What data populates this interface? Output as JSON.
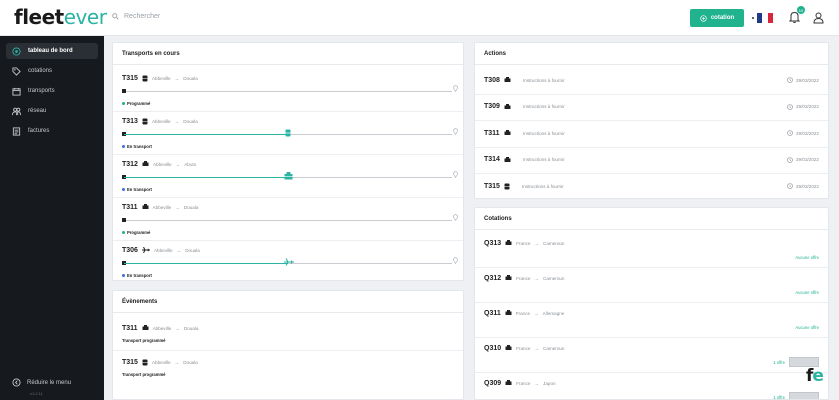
{
  "header": {
    "logo_part1": "fleet",
    "logo_part2": "ever",
    "search_placeholder": "Rechercher",
    "cotation_button": "cotation",
    "notifications_count": "10"
  },
  "sidebar": {
    "items": [
      {
        "label": "tableau de bord",
        "icon": "dashboard-icon"
      },
      {
        "label": "cotations",
        "icon": "tag-icon"
      },
      {
        "label": "transports",
        "icon": "calendar-icon"
      },
      {
        "label": "réseau",
        "icon": "people-icon"
      },
      {
        "label": "factures",
        "icon": "invoice-icon"
      }
    ],
    "collapse_label": "Réduire le menu",
    "version": "v1.2.11"
  },
  "transports": {
    "title": "Transports en cours",
    "items": [
      {
        "ref": "T315",
        "icon": "container-icon",
        "from": "Abbeville",
        "to": "Douala",
        "status": "Programmé",
        "status_color": "#21b38e",
        "progress": 0
      },
      {
        "ref": "T313",
        "icon": "container-icon",
        "from": "Abbeville",
        "to": "Douala",
        "status": "En transport",
        "status_color": "#3b6fd8",
        "progress": 0.5
      },
      {
        "ref": "T312",
        "icon": "truck-icon",
        "from": "Abbeville",
        "to": "Abuto",
        "status": "En transport",
        "status_color": "#3b6fd8",
        "progress": 0.5
      },
      {
        "ref": "T311",
        "icon": "truck-icon",
        "from": "Abbeville",
        "to": "Douala",
        "status": "Programmé",
        "status_color": "#21b38e",
        "progress": 0
      },
      {
        "ref": "T306",
        "icon": "plane-icon",
        "from": "Abbeville",
        "to": "Douala",
        "status": "En transport",
        "status_color": "#3b6fd8",
        "progress": 0.5
      }
    ]
  },
  "evenements": {
    "title": "Évènements",
    "items": [
      {
        "ref": "T311",
        "from": "Abbeville",
        "to": "Douala",
        "text": "Transport programmé"
      },
      {
        "ref": "T315",
        "from": "Abbeville",
        "to": "Douala",
        "text": "Transport programmé"
      }
    ]
  },
  "actions": {
    "title": "Actions",
    "items": [
      {
        "ref": "T308",
        "text": "Instructions à fournir",
        "date": "29/03/2022"
      },
      {
        "ref": "T309",
        "text": "Instructions à fournir",
        "date": "29/03/2022"
      },
      {
        "ref": "T311",
        "text": "Instructions à fournir",
        "date": "29/03/2022"
      },
      {
        "ref": "T314",
        "text": "Instructions à fournir",
        "date": "29/03/2022"
      },
      {
        "ref": "T315",
        "text": "Instructions à fournir",
        "date": "29/03/2022"
      }
    ]
  },
  "cotations": {
    "title": "Cotations",
    "items": [
      {
        "ref": "Q313",
        "from": "France",
        "to": "Cameroun",
        "offer": "Aucune offre"
      },
      {
        "ref": "Q312",
        "from": "France",
        "to": "Cameroun",
        "offer": "Aucune offre"
      },
      {
        "ref": "Q311",
        "from": "France",
        "to": "Allemagne",
        "offer": "Aucune offre"
      },
      {
        "ref": "Q310",
        "from": "France",
        "to": "Cameroun",
        "offer": "1 offre"
      },
      {
        "ref": "Q309",
        "from": "France",
        "to": "Japon",
        "offer": "1 offre"
      }
    ]
  },
  "colors": {
    "accent": "#2bb3a3",
    "button": "#21b38e",
    "sidebar": "#16191d"
  },
  "corner_logo": {
    "p1": "f",
    "p2": "e"
  }
}
